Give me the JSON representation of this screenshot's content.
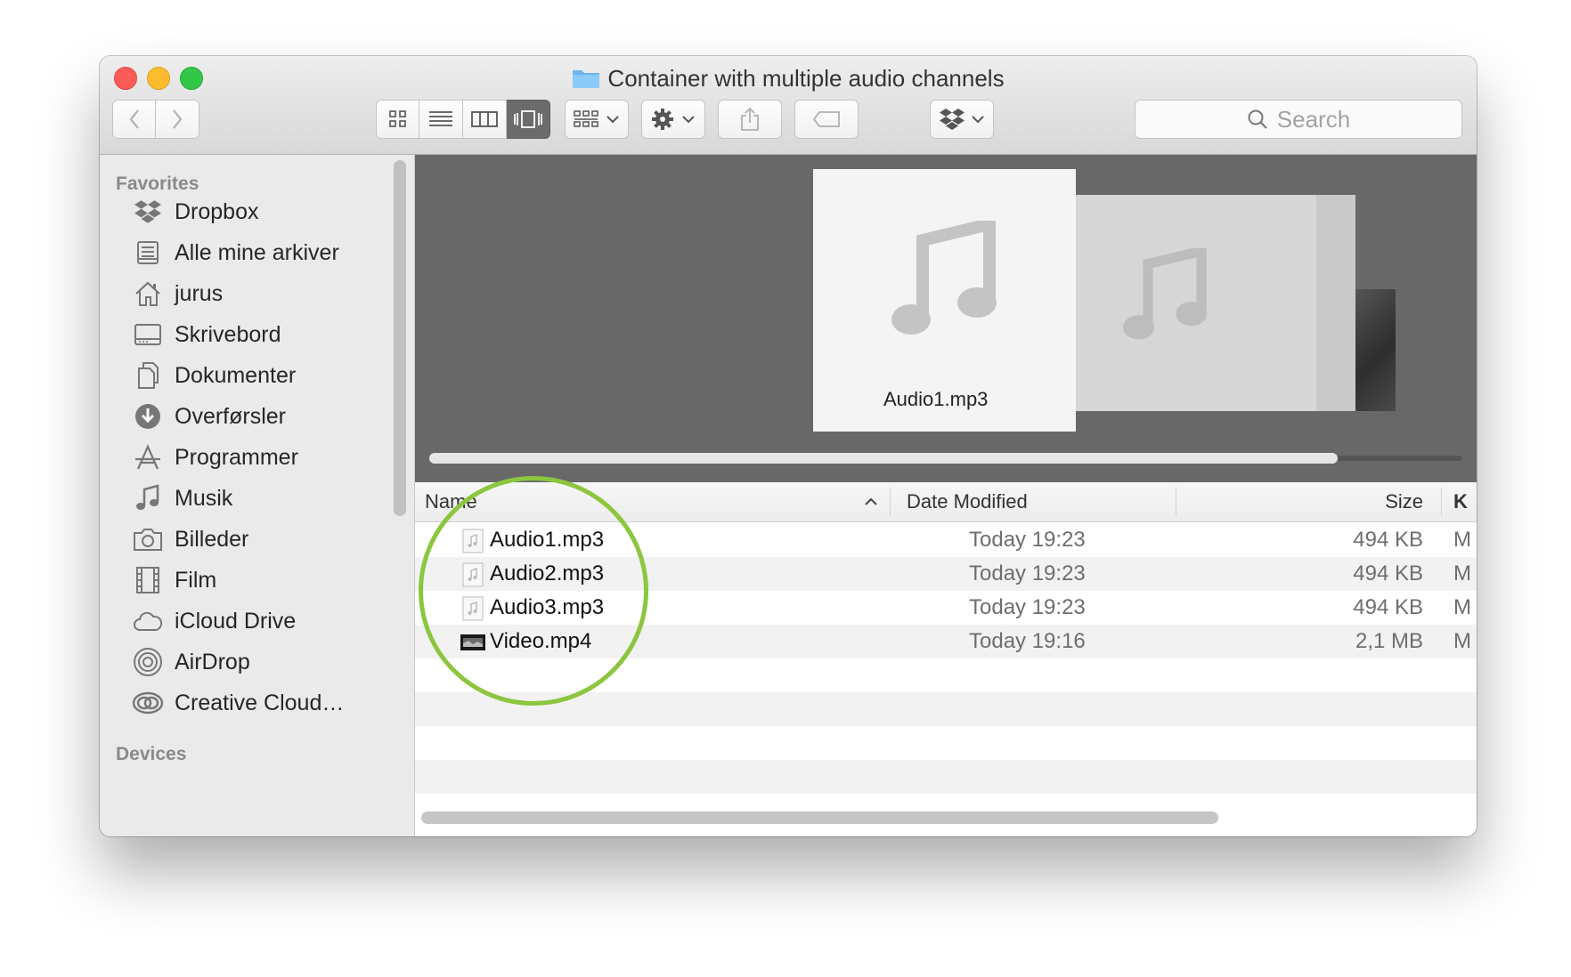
{
  "window": {
    "title": "Container with multiple audio channels"
  },
  "toolbar": {
    "search_placeholder": "Search"
  },
  "sidebar": {
    "favorites_heading": "Favorites",
    "devices_heading": "Devices",
    "items": [
      {
        "label": "Dropbox",
        "icon": "dropbox-icon"
      },
      {
        "label": "Alle mine arkiver",
        "icon": "all-files-icon"
      },
      {
        "label": "jurus",
        "icon": "home-icon"
      },
      {
        "label": "Skrivebord",
        "icon": "desktop-icon"
      },
      {
        "label": "Dokumenter",
        "icon": "documents-icon"
      },
      {
        "label": "Overførsler",
        "icon": "downloads-icon"
      },
      {
        "label": "Programmer",
        "icon": "applications-icon"
      },
      {
        "label": "Musik",
        "icon": "music-icon"
      },
      {
        "label": "Billeder",
        "icon": "camera-icon"
      },
      {
        "label": "Film",
        "icon": "film-icon"
      },
      {
        "label": "iCloud Drive",
        "icon": "cloud-icon"
      },
      {
        "label": "AirDrop",
        "icon": "airdrop-icon"
      },
      {
        "label": "Creative Cloud…",
        "icon": "creative-cloud-icon"
      }
    ]
  },
  "coverflow": {
    "selected_label": "Audio1.mp3"
  },
  "list": {
    "columns": {
      "name": "Name",
      "date": "Date Modified",
      "size": "Size",
      "kind": "K"
    },
    "rows": [
      {
        "name": "Audio1.mp3",
        "date": "Today 19:23",
        "size": "494 KB",
        "kind": "M"
      },
      {
        "name": "Audio2.mp3",
        "date": "Today 19:23",
        "size": "494 KB",
        "kind": "M"
      },
      {
        "name": "Audio3.mp3",
        "date": "Today 19:23",
        "size": "494 KB",
        "kind": "M"
      },
      {
        "name": "Video.mp4",
        "date": "Today 19:16",
        "size": "2,1 MB",
        "kind": "M"
      }
    ]
  },
  "colors": {
    "highlight_circle": "#8cc63f",
    "coverflow_bg": "#686868"
  }
}
